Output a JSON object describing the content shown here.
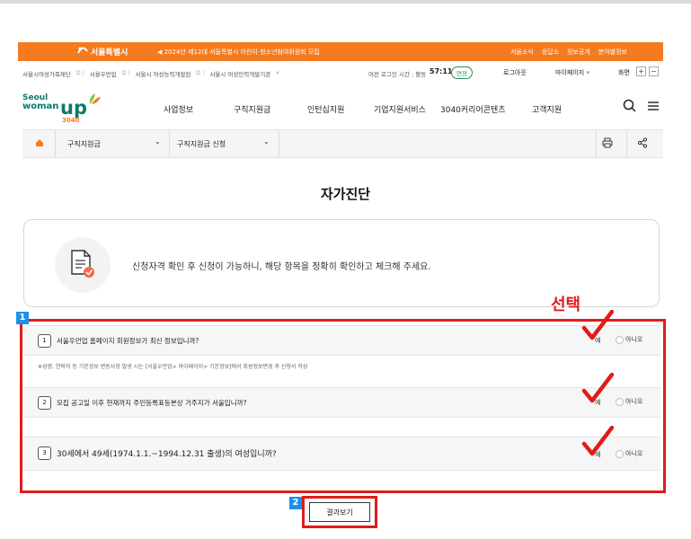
{
  "top_bar": {
    "logo": "서울특별시",
    "notice": "2024년 제12대 서울특별시 어린이·청소년참여위원회 모집",
    "links": [
      "서울소식",
      "응답소",
      "정보공개",
      "분야별정보"
    ]
  },
  "util_bar": {
    "sites": [
      "서울시여성가족재단",
      "서울우먼업",
      "서울시 여성능력개발원",
      "서울시 여성인력개발기관"
    ],
    "login_time_label": "여전 로그인 시간 : 활동",
    "timer": "57:11",
    "extend_label": "연장",
    "logout_label": "로그아웃",
    "mypage_label": "마이페이지",
    "screen_label": "화면",
    "zoom_in": "+",
    "zoom_out": "−"
  },
  "brand": {
    "seoul": "Seoul",
    "woman": "woman",
    "up": "up",
    "sub": "3040"
  },
  "nav": {
    "items": [
      "사업정보",
      "구직지원금",
      "인턴십지원",
      "기업지원서비스",
      "3040커리어콘텐츠",
      "고객지원"
    ]
  },
  "subnav": {
    "dropdown1": "구직지원금",
    "dropdown2": "구직지원금 신청"
  },
  "page": {
    "title": "자가진단",
    "info_message": "신청자격 확인 후 신청이 가능하니, 해당 항목을 정확히 확인하고 체크해 주세요.",
    "select_annotation": "선택"
  },
  "questions": [
    {
      "num": "1",
      "text": "서울우먼업 홈페이지 회원정보가 최신 정보입니까?",
      "yes": "예",
      "no": "아니오"
    },
    {
      "num": "2",
      "text": "모집 공고일 이후 현재까지 주민등록표등본상 거주지가 서울입니까?",
      "yes": "예",
      "no": "아니오"
    },
    {
      "num": "3",
      "text": "30세에서 49세(1974.1.1.~1994.12.31 출생)의 여성입니까?",
      "yes": "예",
      "no": "아니오"
    }
  ],
  "note": "※성명, 연락처 등 기본정보 변동사항 발생 시는 [서울우먼업> 마이페이지> 기본정보]에서 회원정보변경 후 신청서 작성",
  "badges": {
    "one": "1",
    "two": "2"
  },
  "result_button": "결과보기",
  "colors": {
    "brand_orange": "#f47b20",
    "annotation_red": "#e11b1b",
    "badge_blue": "#1e90e8",
    "brand_green": "#0a7b6b"
  }
}
